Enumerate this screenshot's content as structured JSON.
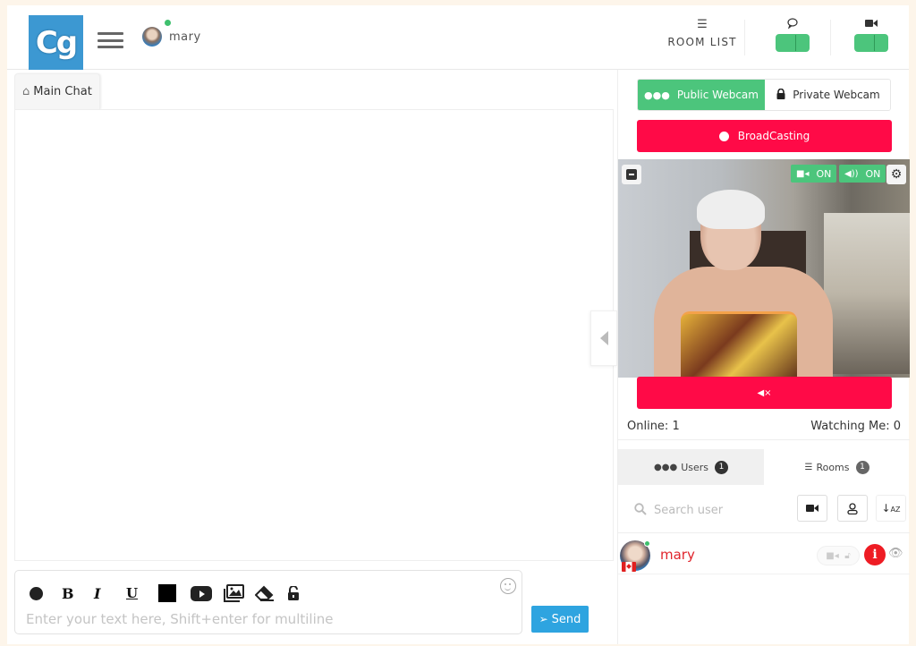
{
  "header": {
    "logo_text": "Cg",
    "user_name": "mary",
    "room_list_label": "ROOM LIST",
    "icons": {
      "menu": "hamburger-icon",
      "room_list": "list-icon",
      "chat_toggle": "speech-bubble-icon",
      "webcam_toggle": "video-camera-icon"
    }
  },
  "chat": {
    "tab_label": "Main Chat",
    "composer_placeholder": "Enter your text here, Shift+enter for multiline",
    "toolbar": [
      "color",
      "bold",
      "italic",
      "underline",
      "background-color",
      "youtube",
      "images",
      "eraser",
      "unlock"
    ],
    "bold_label": "B",
    "italic_label": "I",
    "underline_label": "U",
    "send_label": "Send"
  },
  "webcam": {
    "public_label": "Public Webcam",
    "private_label": "Private Webcam",
    "mode_selected": "Public Webcam",
    "broadcast_label": "BroadCasting",
    "camera_status": "ON",
    "audio_status": "ON",
    "online_label": "Online: 1",
    "watching_label": "Watching Me: 0"
  },
  "lists": {
    "tabs": [
      {
        "label": "Users",
        "count": "1",
        "active": true
      },
      {
        "label": "Rooms",
        "count": "1",
        "active": false
      }
    ],
    "search_placeholder": "Search user",
    "users": [
      {
        "name": "mary",
        "online": true,
        "country": "Canada"
      }
    ]
  },
  "colors": {
    "accent_green": "#4cc57c",
    "broadcast_red": "#ff0a47",
    "send_blue": "#2ea4e0",
    "logo_blue": "#3c98d2",
    "username_red": "#e0242c"
  }
}
